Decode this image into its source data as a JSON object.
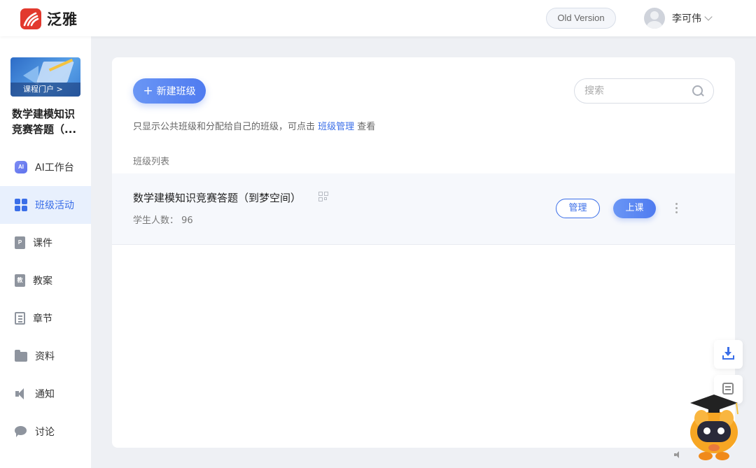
{
  "header": {
    "logo_text": "泛雅",
    "old_version_label": "Old Version",
    "user_name": "李可伟"
  },
  "sidebar": {
    "course_cover_tag": "课程门户 >",
    "course_title": "数学建模知识竞赛答题（...",
    "items": [
      {
        "label": "AI工作台",
        "icon": "ai-workbench-icon",
        "icon_text": "AI"
      },
      {
        "label": "班级活动",
        "icon": "grid-icon",
        "active": true
      },
      {
        "label": "课件",
        "icon": "courseware-icon",
        "icon_text": "P"
      },
      {
        "label": "教案",
        "icon": "lesson-plan-icon",
        "icon_text": "教"
      },
      {
        "label": "章节",
        "icon": "chapter-list-icon"
      },
      {
        "label": "资料",
        "icon": "folder-icon"
      },
      {
        "label": "通知",
        "icon": "speaker-icon"
      },
      {
        "label": "讨论",
        "icon": "chat-icon"
      }
    ]
  },
  "main": {
    "new_class_label": "新建班级",
    "search_placeholder": "搜索",
    "hint_prefix": "只显示公共班级和分配给自己的班级，可点击 ",
    "hint_link": "班级管理",
    "hint_suffix": " 查看",
    "list_label": "班级列表",
    "classes": [
      {
        "name": "数学建模知识竞赛答题（到梦空间）",
        "student_count_label": "学生人数：",
        "student_count": "96",
        "manage_label": "管理",
        "start_label": "上课"
      }
    ]
  },
  "colors": {
    "accent": "#3a6ee8",
    "logo_red": "#e2392e",
    "active_bg": "#e8f0fd"
  }
}
